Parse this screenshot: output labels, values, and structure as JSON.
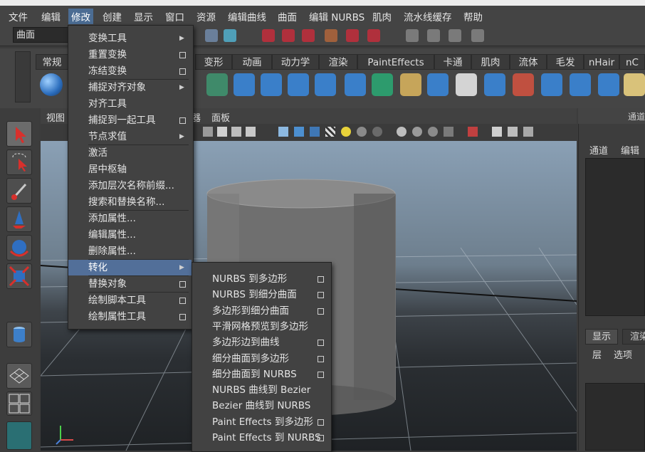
{
  "menubar": {
    "items": [
      "文件",
      "编辑",
      "修改",
      "创建",
      "显示",
      "窗口",
      "资源",
      "编辑曲线",
      "曲面",
      "编辑 NURBS",
      "肌肉",
      "流水线缓存",
      "帮助"
    ],
    "active_index": 2
  },
  "toolbar": {
    "mode_value": "曲面"
  },
  "shelf": {
    "tabs": [
      "常规",
      "变形",
      "动画",
      "动力学",
      "渲染",
      "PaintEffects",
      "卡通",
      "肌肉",
      "流体",
      "毛发",
      "nHair",
      "nC"
    ]
  },
  "viewport": {
    "menu": [
      "视图",
      "器",
      "面板"
    ]
  },
  "right_panel": {
    "title": "通道",
    "menu": [
      "通道",
      "编辑"
    ],
    "tabs": [
      "显示",
      "渲染"
    ],
    "layer_menu": [
      "层",
      "选项"
    ]
  },
  "modify_menu": {
    "items": [
      {
        "label": "变换工具",
        "suffix": "arrow"
      },
      {
        "label": "重置变换",
        "suffix": "box"
      },
      {
        "label": "冻结变换",
        "suffix": "box"
      },
      {
        "label": "捕捉对齐对象",
        "suffix": "arrow"
      },
      {
        "label": "对齐工具",
        "suffix": ""
      },
      {
        "label": "捕捉到一起工具",
        "suffix": "box"
      },
      {
        "label": "节点求值",
        "suffix": "arrow"
      },
      {
        "label": "激活",
        "suffix": ""
      },
      {
        "label": "居中枢轴",
        "suffix": ""
      },
      {
        "label": "添加层次名称前缀...",
        "suffix": ""
      },
      {
        "label": "搜索和替换名称...",
        "suffix": ""
      },
      {
        "label": "添加属性...",
        "suffix": ""
      },
      {
        "label": "编辑属性...",
        "suffix": ""
      },
      {
        "label": "删除属性...",
        "suffix": ""
      },
      {
        "label": "转化",
        "suffix": "arrow",
        "highlighted": true
      },
      {
        "label": "替换对象",
        "suffix": "box"
      },
      {
        "label": "绘制脚本工具",
        "suffix": "box"
      },
      {
        "label": "绘制属性工具",
        "suffix": "box"
      }
    ]
  },
  "convert_menu": {
    "items": [
      {
        "label": "NURBS 到多边形",
        "suffix": "box"
      },
      {
        "label": "NURBS 到细分曲面",
        "suffix": "box"
      },
      {
        "label": "多边形到细分曲面",
        "suffix": "box"
      },
      {
        "label": "平滑网格预览到多边形",
        "suffix": ""
      },
      {
        "label": "多边形边到曲线",
        "suffix": "box"
      },
      {
        "label": "细分曲面到多边形",
        "suffix": "box"
      },
      {
        "label": "细分曲面到 NURBS",
        "suffix": "box"
      },
      {
        "label": "NURBS 曲线到 Bezier",
        "suffix": ""
      },
      {
        "label": "Bezier 曲线到 NURBS",
        "suffix": ""
      },
      {
        "label": "Paint Effects 到多边形",
        "suffix": "box"
      },
      {
        "label": "Paint Effects 到 NURBS",
        "suffix": "box"
      }
    ]
  },
  "colors": {
    "menu_highlight": "#526f99",
    "menubar_active": "#4b6c93",
    "tool_red": "#c0392b",
    "tool_blue": "#2f6fc2"
  }
}
